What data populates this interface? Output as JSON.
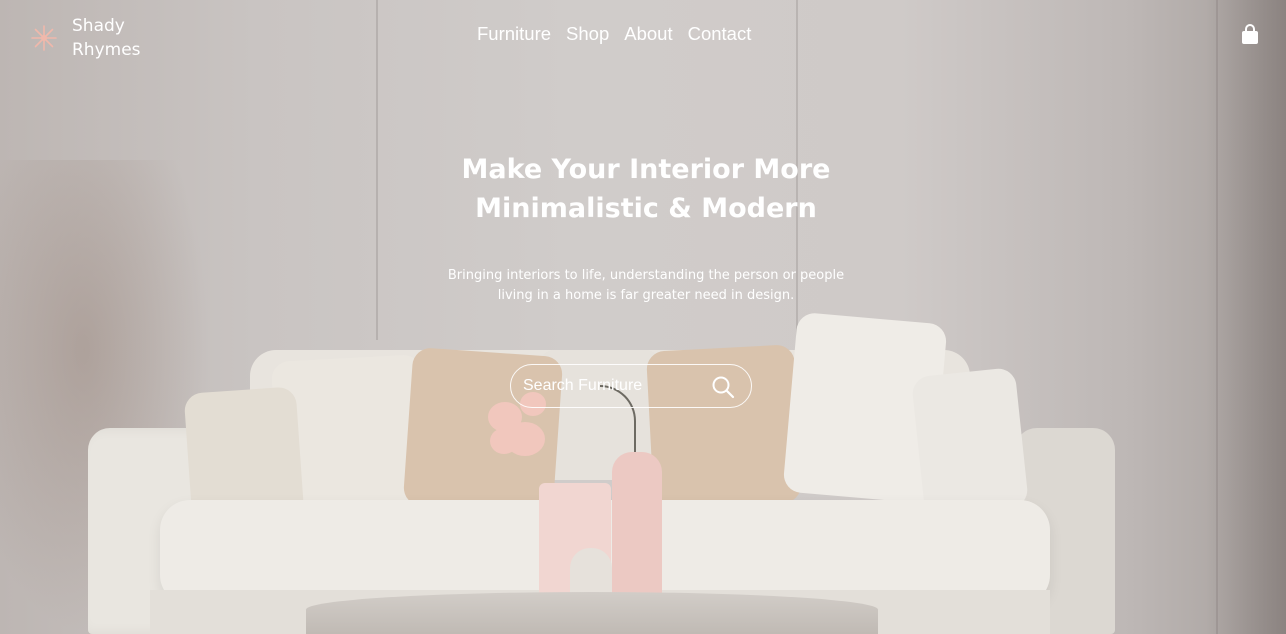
{
  "brand": {
    "name_line1": "Shady",
    "name_line2": "Rhymes",
    "logo_icon": "sparkle-icon",
    "accent": "#f0b8ab"
  },
  "nav": {
    "items": [
      {
        "label": "Furniture"
      },
      {
        "label": "Shop"
      },
      {
        "label": "About"
      },
      {
        "label": "Contact"
      }
    ]
  },
  "cart": {
    "icon": "shopping-bag-icon"
  },
  "hero": {
    "title_line1": "Make Your Interior More",
    "title_line2": "Minimalistic & Modern",
    "subtitle_line1": "Bringing interiors to life, understanding the person or people",
    "subtitle_line2": "living in a home is far greater need in design."
  },
  "search": {
    "placeholder": "Search Furniture",
    "icon": "search-icon"
  }
}
